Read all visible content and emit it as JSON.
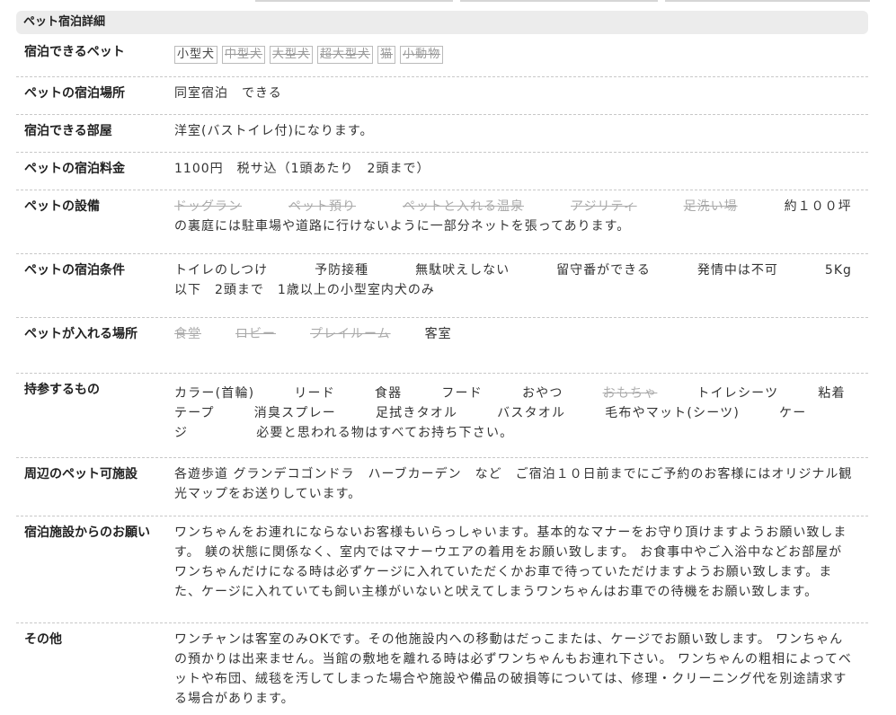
{
  "section_title": "ペット宿泊詳細",
  "rows": {
    "pets": {
      "label": "宿泊できるペット",
      "badges": [
        {
          "label": "小型犬",
          "available": true
        },
        {
          "label": "中型犬",
          "available": false
        },
        {
          "label": "大型犬",
          "available": false
        },
        {
          "label": "超大型犬",
          "available": false
        },
        {
          "label": "猫",
          "available": false
        },
        {
          "label": "小動物",
          "available": false
        }
      ]
    },
    "location": {
      "label": "ペットの宿泊場所",
      "value": "同室宿泊　できる"
    },
    "room": {
      "label": "宿泊できる部屋",
      "value": "洋室(バストイレ付)になります。"
    },
    "fee": {
      "label": "ペットの宿泊料金",
      "value": "1100円　税サ込（1頭あたり　2頭まで）"
    },
    "facilities": {
      "label": "ペットの設備",
      "items": [
        "ドッグラン",
        "ペット預り",
        "ペットと入れる温泉",
        "アジリティ",
        "足洗い場"
      ],
      "text": "約１００坪の裏庭には駐車場や道路に行けないように一部分ネットを張ってあります。"
    },
    "conditions": {
      "label": "ペットの宿泊条件",
      "items": [
        "トイレのしつけ",
        "予防接種",
        "無駄吠えしない",
        "留守番ができる",
        "発情中は不可"
      ],
      "text": "5Kg以下　2頭まで　1歳以上の小型室内犬のみ"
    },
    "areas": {
      "label": "ペットが入れる場所",
      "items": [
        "食堂",
        "ロビー",
        "プレイルーム"
      ],
      "allowed": "客室"
    },
    "bring": {
      "label": "持参するもの",
      "items_a": [
        "カラー(首輪)",
        "リード",
        "食器",
        "フード",
        "おやつ"
      ],
      "struck": "おもちゃ",
      "items_b": [
        "トイレシーツ",
        "粘着テープ",
        "消臭スプレー",
        "足拭きタオル",
        "バスタオル",
        "毛布やマット(シーツ)",
        "ケージ"
      ],
      "text": "必要と思われる物はすべてお持ち下さい。"
    },
    "nearby": {
      "label": "周辺のペット可施設",
      "value": "各遊歩道 グランデコゴンドラ　ハーブカーデン　など　ご宿泊１０日前までにご予約のお客様にはオリジナル観光マップをお送りしています。"
    },
    "request": {
      "label": "宿泊施設からのお願い",
      "value": "ワンちゃんをお連れにならないお客様もいらっしゃいます。基本的なマナーをお守り頂けますようお願い致します。 躾の状態に関係なく、室内ではマナーウエアの着用をお願い致します。 お食事中やご入浴中などお部屋がワンちゃんだけになる時は必ずケージに入れていただくかお車で待っていただけますようお願い致します。また、ケージに入れていても飼い主様がいないと吠えてしまうワンちゃんはお車での待機をお願い致します。"
    },
    "other": {
      "label": "その他",
      "value": "ワンチャンは客室のみOKです。その他施設内への移動はだっこまたは、ケージでお願い致します。 ワンちゃんの預かりは出来ません。当館の敷地を離れる時は必ずワンちゃんもお連れ下さい。 ワンちゃんの粗相によってベットや布団、絨毯を汚してしまった場合や施設や備品の破損等については、修理・クリーニング代を別途請求する場合があります。"
    }
  }
}
